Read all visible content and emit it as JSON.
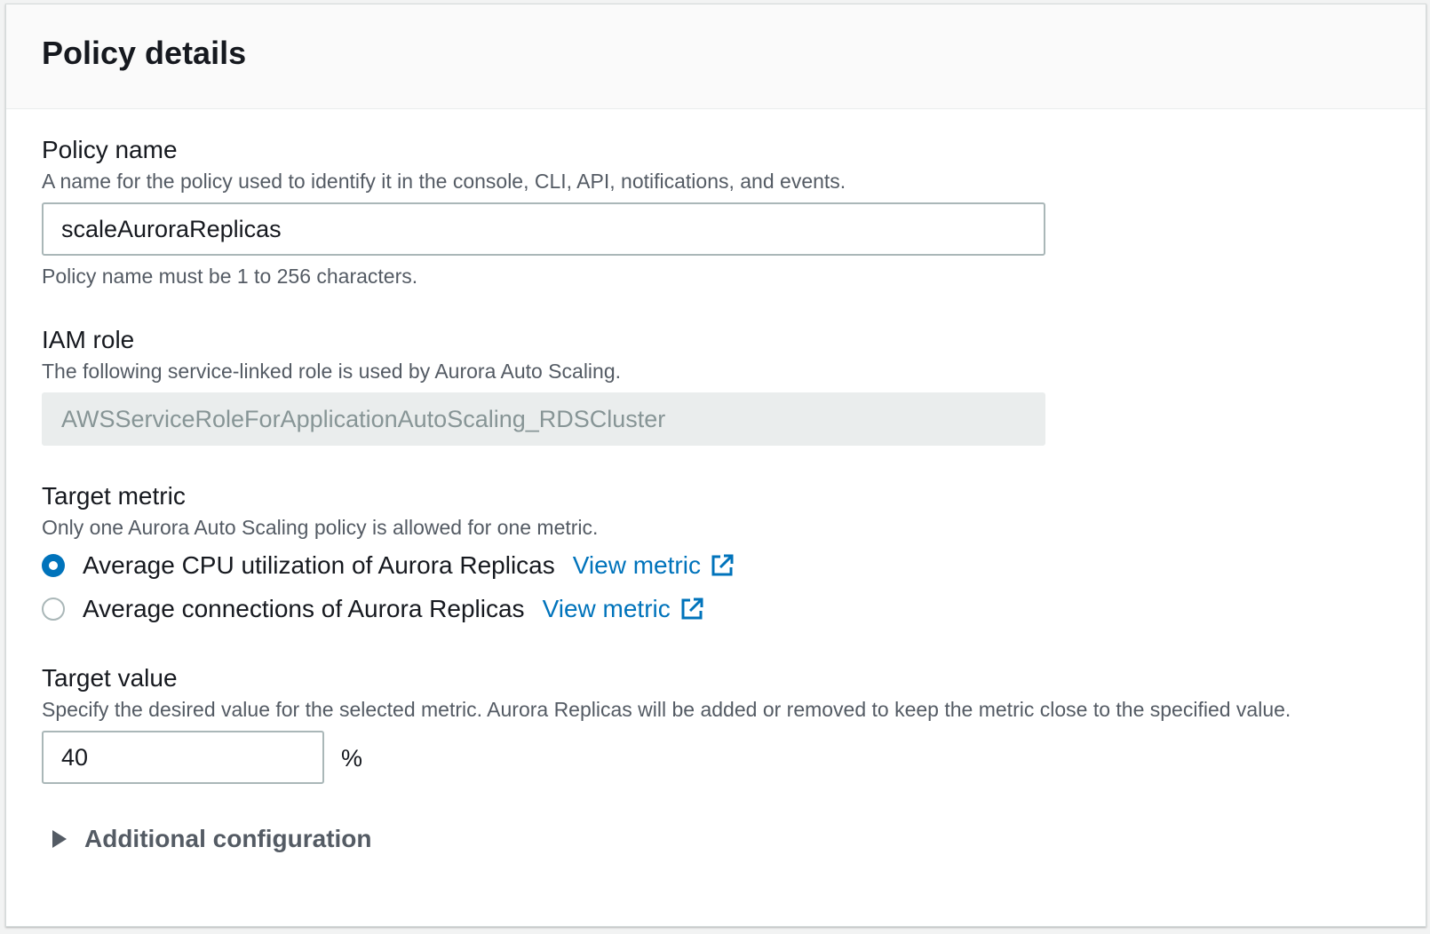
{
  "panel": {
    "title": "Policy details"
  },
  "policy_name": {
    "label": "Policy name",
    "description": "A name for the policy used to identify it in the console, CLI, API, notifications, and events.",
    "value": "scaleAuroraReplicas",
    "constraint": "Policy name must be 1 to 256 characters."
  },
  "iam_role": {
    "label": "IAM role",
    "description": "The following service-linked role is used by Aurora Auto Scaling.",
    "value": "AWSServiceRoleForApplicationAutoScaling_RDSCluster"
  },
  "target_metric": {
    "label": "Target metric",
    "description": "Only one Aurora Auto Scaling policy is allowed for one metric.",
    "options": [
      {
        "label": "Average CPU utilization of Aurora Replicas",
        "link": "View metric",
        "selected": true
      },
      {
        "label": "Average connections of Aurora Replicas",
        "link": "View metric",
        "selected": false
      }
    ]
  },
  "target_value": {
    "label": "Target value",
    "description": "Specify the desired value for the selected metric. Aurora Replicas will be added or removed to keep the metric close to the specified value.",
    "value": "40",
    "unit": "%"
  },
  "additional_config": {
    "label": "Additional configuration",
    "expanded": false
  },
  "colors": {
    "link": "#0073bb",
    "radio_selected": "#0073bb",
    "label": "#16191f",
    "description": "#545b64"
  }
}
